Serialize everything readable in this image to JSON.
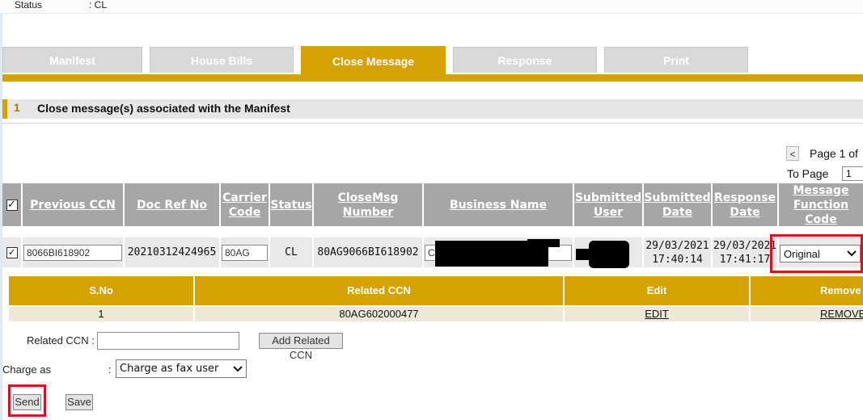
{
  "header": {
    "status_label": "Status",
    "status_value": ": CL"
  },
  "tabs": [
    {
      "label": "Manifest",
      "active": false
    },
    {
      "label": "House Bills",
      "active": false
    },
    {
      "label": "Close Message",
      "active": true
    },
    {
      "label": "Response",
      "active": false
    },
    {
      "label": "Print",
      "active": false
    }
  ],
  "section": {
    "number": "1",
    "title": "Close message(s) associated with the Manifest"
  },
  "pager": {
    "prev": "<",
    "text": "Page 1 of",
    "to_page_label": "To Page",
    "to_page_value": "1"
  },
  "table": {
    "headers": {
      "previous_ccn": "Previous CCN",
      "doc_ref_no": "Doc Ref No",
      "carrier_code": "Carrier Code",
      "status": "Status",
      "closemsg_number": "CloseMsg Number",
      "business_name": "Business Name",
      "submitted_user": "Submitted User",
      "submitted_date": "Submitted Date",
      "response_date": "Response Date",
      "message_function_code": "Message Function Code"
    },
    "row": {
      "checked": true,
      "previous_ccn": "8066BI618902",
      "doc_ref_no": "20210312424965",
      "carrier_code": "80AG",
      "status": "CL",
      "closemsg_number": "80AG9066BI618902",
      "business_name": "C",
      "submitted_date": "29/03/2021",
      "submitted_time": "17:40:14",
      "response_date": "29/03/2021",
      "response_time": "17:41:17",
      "message_function_code": "Original"
    }
  },
  "related_table": {
    "headers": {
      "sno": "S.No",
      "related_ccn": "Related CCN",
      "edit": "Edit",
      "remove": "Remove"
    },
    "rows": [
      {
        "sno": "1",
        "related_ccn": "80AG602000477",
        "edit": "EDIT",
        "remove": "REMOVE"
      }
    ]
  },
  "form": {
    "related_ccn_label": "Related CCN :",
    "related_ccn_value": "",
    "add_related_ccn": "Add Related CCN",
    "charge_as_label": "Charge as",
    "charge_as_colon": ":",
    "charge_as_value": "Charge as fax user",
    "send": "Send",
    "save": "Save"
  }
}
